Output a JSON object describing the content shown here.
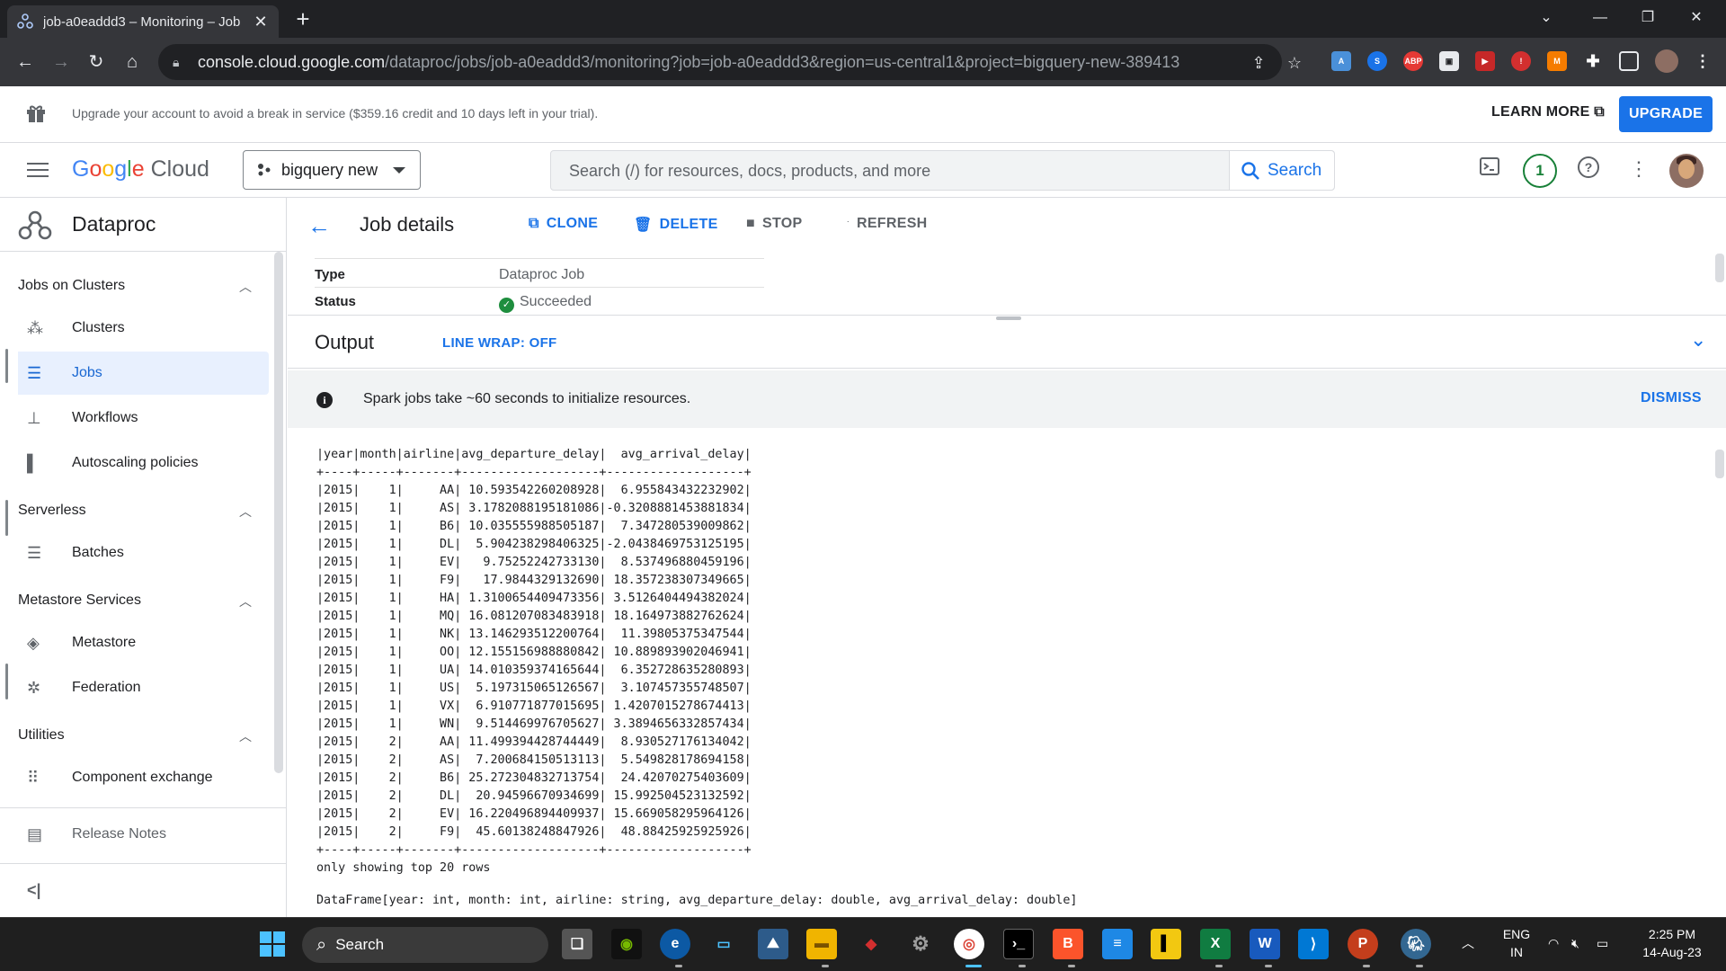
{
  "browser": {
    "tab_title": "job-a0eaddd3 – Monitoring – Job",
    "url_host": "console.cloud.google.com",
    "url_path": "/dataproc/jobs/job-a0eaddd3/monitoring?job=job-a0eaddd3&region=us-central1&project=bigquery-new-389413",
    "extensions": [
      "abp-icon",
      "puzzle-icon"
    ],
    "ext_abp": "ABP"
  },
  "banner": {
    "message": "Upgrade your account to avoid a break in service ($359.16 credit and 10 days left in your trial).",
    "learn_more": "LEARN MORE",
    "upgrade": "UPGRADE"
  },
  "header": {
    "logo_google": "Google",
    "logo_cloud": "Cloud",
    "project": "bigquery new",
    "search_placeholder": "Search (/) for resources, docs, products, and more",
    "search_button": "Search",
    "notification_count": "1"
  },
  "sidebar": {
    "product": "Dataproc",
    "sections": {
      "jobs_on_clusters": "Jobs on Clusters",
      "serverless": "Serverless",
      "metastore_services": "Metastore Services",
      "utilities": "Utilities"
    },
    "items": {
      "clusters": "Clusters",
      "jobs": "Jobs",
      "workflows": "Workflows",
      "autoscaling": "Autoscaling policies",
      "batches": "Batches",
      "metastore": "Metastore",
      "federation": "Federation",
      "component_exchange": "Component exchange",
      "release_notes": "Release Notes"
    },
    "collapse": "<|"
  },
  "job": {
    "title": "Job details",
    "actions": {
      "clone": "CLONE",
      "delete": "DELETE",
      "stop": "STOP",
      "refresh": "REFRESH"
    },
    "fields": [
      {
        "key": "Type",
        "value": "Dataproc Job"
      },
      {
        "key": "Status",
        "value": "Succeeded"
      }
    ]
  },
  "output": {
    "title": "Output",
    "line_wrap": "LINE WRAP: OFF",
    "info_message": "Spark jobs take ~60 seconds to initialize resources.",
    "dismiss": "DISMISS",
    "header_line": "|year|month|airline|avg_departure_delay|  avg_arrival_delay|",
    "separator": "+----+-----+-------+-------------------+-------------------+",
    "rows": [
      "|2015|    1|     AA| 10.593542260208928|  6.955843432232902|",
      "|2015|    1|     AS| 3.1782088195181086|-0.3208881453881834|",
      "|2015|    1|     B6| 10.035555988505187|  7.347280539009862|",
      "|2015|    1|     DL|  5.904238298406325|-2.0438469753125195|",
      "|2015|    1|     EV|   9.75252242733130|  8.537496880459196|",
      "|2015|    1|     F9|   17.9844329132690| 18.357238307349665|",
      "|2015|    1|     HA| 1.3100654409473356| 3.5126404494382024|",
      "|2015|    1|     MQ| 16.081207083483918| 18.164973882762624|",
      "|2015|    1|     NK| 13.146293512200764|  11.39805375347544|",
      "|2015|    1|     OO| 12.155156988880842| 10.889893902046941|",
      "|2015|    1|     UA| 14.010359374165644|  6.352728635280893|",
      "|2015|    1|     US|  5.197315065126567|  3.107457355748507|",
      "|2015|    1|     VX|  6.910771877015695| 1.4207015278674413|",
      "|2015|    1|     WN|  9.514469976705627| 3.3894656332857434|",
      "|2015|    2|     AA| 11.499394428744449|  8.930527176134042|",
      "|2015|    2|     AS|  7.200684150513113|  5.549828178694158|",
      "|2015|    2|     B6| 25.272304832713754|  24.42070275403609|",
      "|2015|    2|     DL|  20.94596670934699| 15.992504523132592|",
      "|2015|    2|     EV| 16.220496894409937| 15.669058295964126|",
      "|2015|    2|     F9|  45.60138248847926|  48.88425925925926|"
    ],
    "footer": "only showing top 20 rows",
    "dataframe": "DataFrame[year: int, month: int, airline: string, avg_departure_delay: double, avg_arrival_delay: double]"
  },
  "taskbar": {
    "search": "Search",
    "lang_top": "ENG",
    "lang_bottom": "IN",
    "time": "2:25 PM",
    "date": "14-Aug-23"
  },
  "colors": {
    "accent": "#1a73e8",
    "success": "#1e8e3e"
  }
}
